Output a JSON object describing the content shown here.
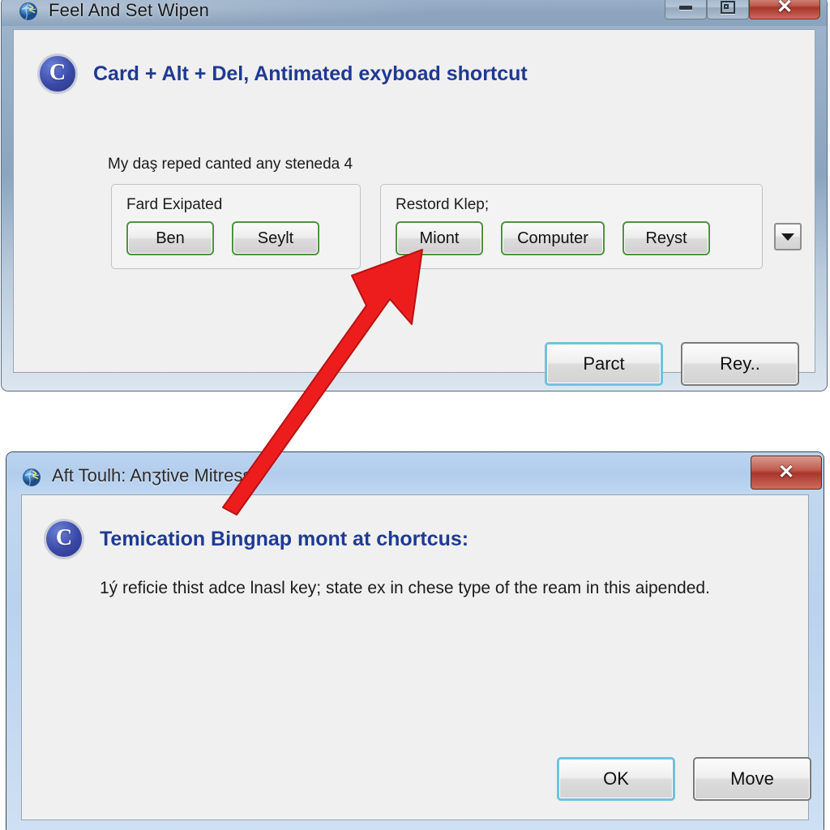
{
  "window1": {
    "title": "Feel And Set Wipen",
    "icon": "globe-icon",
    "controls": {
      "minimize": "minimize-icon",
      "maximize": "maximize-icon",
      "close": "✕"
    },
    "heading": "Card + Alt + Del,  Antimated exyboad shortcut",
    "heading_icon_letter": "C",
    "subtext": "My daş reped canted any steneda 4",
    "groups": [
      {
        "label": "Fard Exipated",
        "buttons": [
          "Ben",
          "Seylt"
        ]
      },
      {
        "label": "Restord Klep;",
        "buttons": [
          "Miont",
          "Computer",
          "Reyst"
        ]
      }
    ],
    "dropdown": "chevron-down-icon",
    "footer_buttons": [
      {
        "label": "Parct",
        "style": "default"
      },
      {
        "label": "Rey..",
        "style": "normal"
      }
    ]
  },
  "window2": {
    "title": "Aft Toulh: Anʒtive Mitress",
    "icon": "globe-icon",
    "controls": {
      "close": "✕"
    },
    "heading": "Temication Bingnap mont at chortcus:",
    "heading_icon_letter": "C",
    "body": "1ý reficie thist adce lnasl key; state ex in chese type of the ream in this aipended.",
    "footer_buttons": [
      {
        "label": "OK",
        "style": "default"
      },
      {
        "label": "Move",
        "style": "normal"
      }
    ]
  },
  "annotation": {
    "arrow": "red-arrow-annotation",
    "color": "#ee1d1d"
  },
  "colors": {
    "heading_blue": "#1f3a93",
    "button_green_border": "#4f9140",
    "default_button_border": "#6fc3dd",
    "close_red": "#a8352b",
    "titlebar_win1": "#8ca4be",
    "titlebar_win2": "#b2cdec",
    "client_bg": "#f0f0f0"
  }
}
